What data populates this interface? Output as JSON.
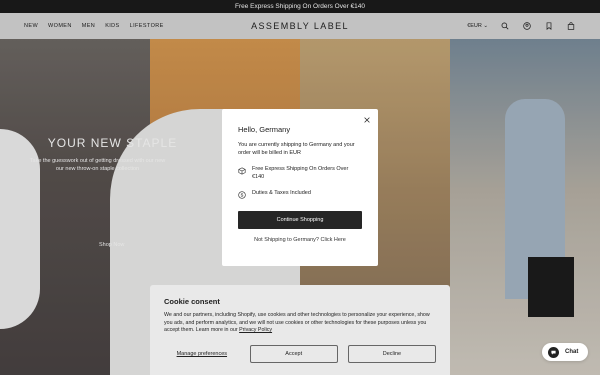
{
  "announcement": {
    "text": "Free Express Shipping On Orders Over €140"
  },
  "header": {
    "nav": [
      "NEW",
      "WOMEN",
      "MEN",
      "KIDS",
      "LIFESTORE"
    ],
    "logo": "ASSEMBLY LABEL",
    "currency": "€EUR",
    "icons": [
      "search-icon",
      "account-icon",
      "wishlist-icon",
      "bag-icon"
    ]
  },
  "hero": {
    "title": "YOUR NEW STAPLE",
    "subtitle_line1": "Take the guesswork out of getting dressed with our new",
    "subtitle_line2": "our new throw-on staple collection",
    "cta": "Shop Now"
  },
  "modal": {
    "title": "Hello, Germany",
    "text": "You are currently shipping to Germany and your order will be billed in EUR",
    "shipping": "Free Express Shipping On Orders Over €140",
    "duties": "Duties & Taxes Included",
    "button": "Continue Shopping",
    "link": "Not Shipping to Germany? Click Here"
  },
  "cookie": {
    "title": "Cookie consent",
    "text": "We and our partners, including Shopify, use cookies and other technologies to personalize your experience, show you ads, and perform analytics, and we will not use cookies or other technologies for these purposes unless you accept them. Learn more in our",
    "policy_link": "Privacy Policy",
    "manage": "Manage preferences",
    "accept": "Accept",
    "decline": "Decline"
  },
  "chat": {
    "label": "Chat"
  }
}
